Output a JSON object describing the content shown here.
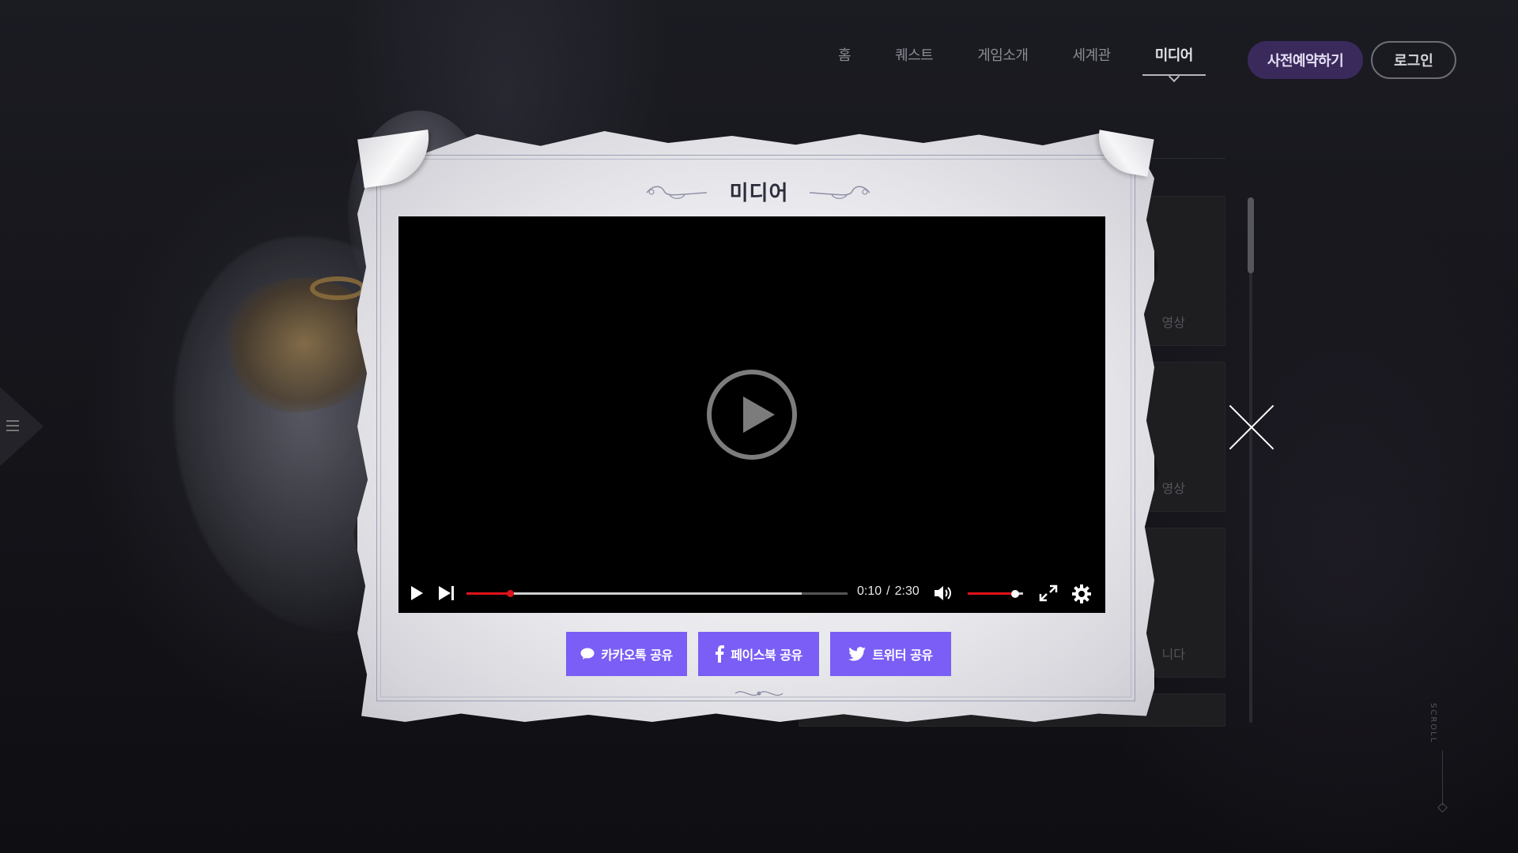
{
  "nav": {
    "items": [
      {
        "label": "홈",
        "active": false
      },
      {
        "label": "퀘스트",
        "active": false
      },
      {
        "label": "게임소개",
        "active": false
      },
      {
        "label": "세계관",
        "active": false
      },
      {
        "label": "미디어",
        "active": true
      }
    ],
    "preregister_label": "사전예약하기",
    "login_label": "로그인"
  },
  "modal": {
    "title": "미디어",
    "video": {
      "current_time": "0:10",
      "separator": "/",
      "duration": "2:30",
      "played_fraction": 0.115,
      "buffered_fraction": 0.88,
      "volume_fraction": 0.85
    },
    "share": {
      "kakao_label": "카카오톡 공유",
      "facebook_label": "페이스북 공유",
      "twitter_label": "트위터 공유"
    }
  },
  "media_list": {
    "captions": [
      "영상",
      "영상",
      "니다"
    ]
  },
  "scroll_hint": "SCROLL",
  "colors": {
    "accent": "#7a5ef5",
    "progress": "#e0121a",
    "preregister_bg": "#3a2a5c"
  }
}
